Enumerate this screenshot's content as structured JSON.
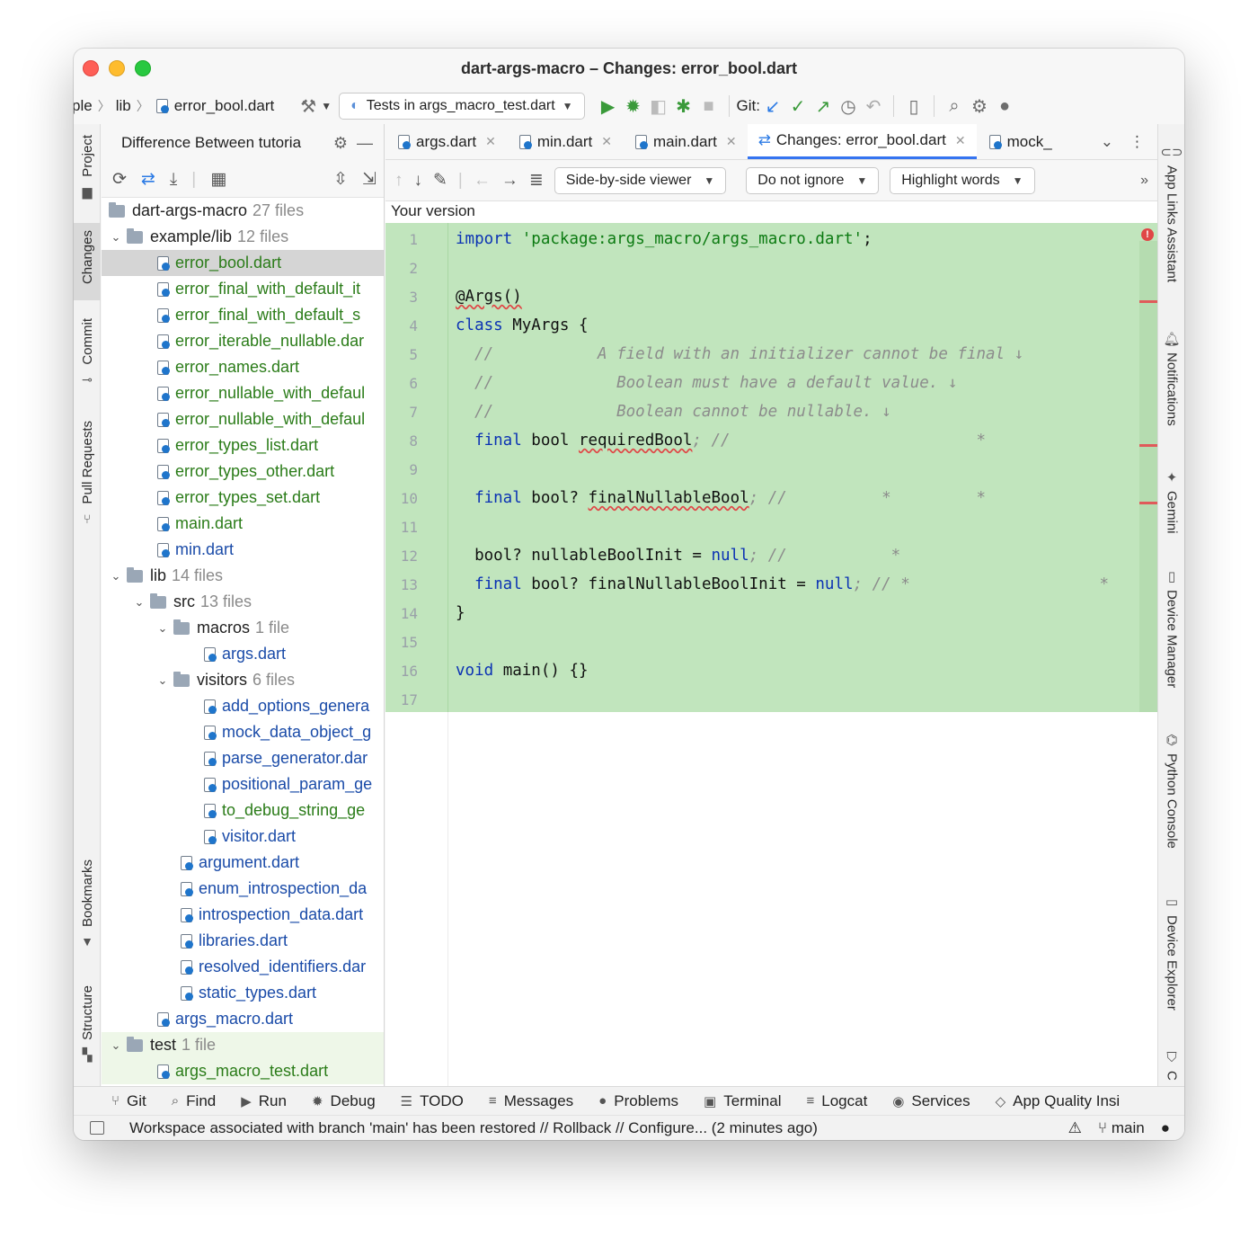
{
  "window": {
    "title": "dart-args-macro – Changes: error_bool.dart"
  },
  "toolbar": {
    "breadcrumb": [
      "ple",
      "lib",
      "error_bool.dart"
    ],
    "run_config": "Tests in args_macro_test.dart",
    "git_label": "Git:"
  },
  "left_stripe": {
    "project": "Project",
    "changes": "Changes",
    "commit": "Commit",
    "pull_requests": "Pull Requests",
    "bookmarks": "Bookmarks",
    "structure": "Structure"
  },
  "right_stripe": {
    "app_links": "App Links Assistant",
    "notifications": "Notifications",
    "gemini": "Gemini",
    "device_manager": "Device Manager",
    "python_console": "Python Console",
    "device_explorer": "Device Explorer",
    "truncated": "C"
  },
  "changes_panel": {
    "header": "Difference Between tutoria",
    "root": {
      "name": "dart-args-macro",
      "count": "27 files"
    },
    "example_lib": {
      "name": "example/lib",
      "count": "12 files"
    },
    "example_files": [
      "error_bool.dart",
      "error_final_with_default_it",
      "error_final_with_default_s",
      "error_iterable_nullable.dar",
      "error_names.dart",
      "error_nullable_with_defaul",
      "error_nullable_with_defaul",
      "error_types_list.dart",
      "error_types_other.dart",
      "error_types_set.dart",
      "main.dart",
      "min.dart"
    ],
    "lib": {
      "name": "lib",
      "count": "14 files"
    },
    "src": {
      "name": "src",
      "count": "13 files"
    },
    "macros": {
      "name": "macros",
      "count": "1 file"
    },
    "macros_files": [
      "args.dart"
    ],
    "visitors": {
      "name": "visitors",
      "count": "6 files"
    },
    "visitors_files": [
      "add_options_genera",
      "mock_data_object_g",
      "parse_generator.dar",
      "positional_param_ge",
      "to_debug_string_ge",
      "visitor.dart"
    ],
    "src_files": [
      "argument.dart",
      "enum_introspection_da",
      "introspection_data.dart",
      "libraries.dart",
      "resolved_identifiers.dar",
      "static_types.dart"
    ],
    "lib_files": [
      "args_macro.dart"
    ],
    "test": {
      "name": "test",
      "count": "1 file"
    },
    "test_files": [
      "args_macro_test.dart"
    ]
  },
  "editor": {
    "tabs": [
      "args.dart",
      "min.dart",
      "main.dart",
      "Changes: error_bool.dart",
      "mock_"
    ],
    "viewer_mode": "Side-by-side viewer",
    "ignore_mode": "Do not ignore",
    "highlight_mode": "Highlight words",
    "pane_label": "Your version",
    "line_numbers": [
      "1",
      "2",
      "3",
      "4",
      "5",
      "6",
      "7",
      "8",
      "9",
      "10",
      "11",
      "12",
      "13",
      "14",
      "15",
      "16",
      "17"
    ],
    "code": {
      "l1_kw": "import",
      "l1_str": "'package:args_macro/args_macro.dart'",
      "l1_end": ";",
      "l3": "@Args()",
      "l4_kw": "class",
      "l4_rest": " MyArgs {",
      "l5": "  //           A field with an initializer cannot be final ↓",
      "l6": "  //             Boolean must have a default value. ↓",
      "l7": "  //             Boolean cannot be nullable. ↓",
      "l8_kw": "final",
      "l8_type": " bool ",
      "l8_name": "requiredBool",
      "l8_cm": "; //                          *",
      "l10_kw": "final",
      "l10_type": " bool? ",
      "l10_name": "finalNullableBool",
      "l10_cm": "; //          *         *",
      "l12_pre": "  bool? nullableBoolInit = ",
      "l12_null": "null",
      "l12_cm": "; //           *",
      "l13_kw": "final",
      "l13_mid": " bool? finalNullableBoolInit = ",
      "l13_null": "null",
      "l13_cm": "; // *                    *",
      "l14": "}",
      "l16_kw": "void",
      "l16_rest": " main() {}"
    }
  },
  "bottom_tools": [
    "Git",
    "Find",
    "Run",
    "Debug",
    "TODO",
    "Messages",
    "Problems",
    "Terminal",
    "Logcat",
    "Services",
    "App Quality Insi"
  ],
  "status": {
    "message": "Workspace associated with branch 'main' has been restored // Rollback // Configure... (2 minutes ago)",
    "branch": "main"
  }
}
